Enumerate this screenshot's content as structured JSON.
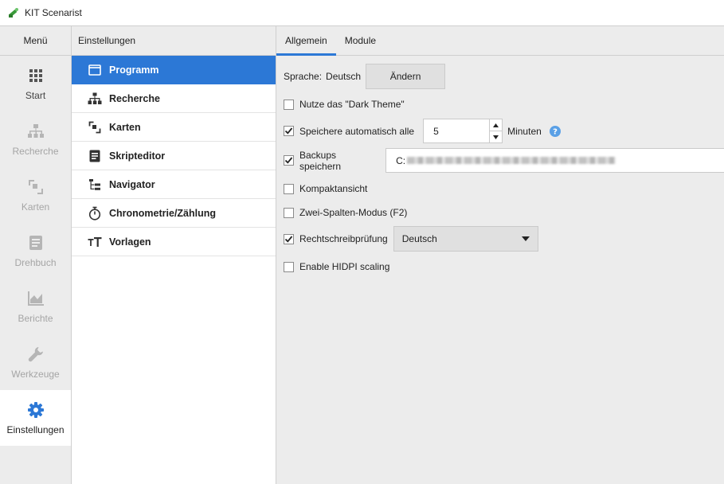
{
  "window": {
    "title": "KIT Scenarist"
  },
  "leftnav": {
    "header": "Menü",
    "items": [
      {
        "label": "Start"
      },
      {
        "label": "Recherche"
      },
      {
        "label": "Karten"
      },
      {
        "label": "Drehbuch"
      },
      {
        "label": "Berichte"
      },
      {
        "label": "Werkzeuge"
      },
      {
        "label": "Einstellungen"
      }
    ]
  },
  "categories": {
    "header": "Einstellungen",
    "items": [
      {
        "label": "Programm",
        "icon": "window-icon",
        "active": true
      },
      {
        "label": "Recherche",
        "icon": "hierarchy-icon"
      },
      {
        "label": "Karten",
        "icon": "cards-icon"
      },
      {
        "label": "Skripteditor",
        "icon": "script-icon"
      },
      {
        "label": "Navigator",
        "icon": "tree-icon"
      },
      {
        "label": "Chronometrie/Zählung",
        "icon": "stopwatch-icon"
      },
      {
        "label": "Vorlagen",
        "icon": "text-size-icon"
      }
    ]
  },
  "tabs": [
    {
      "label": "Allgemein",
      "active": true
    },
    {
      "label": "Module"
    }
  ],
  "settings": {
    "language_label": "Sprache:",
    "language_value": "Deutsch",
    "change_button": "Ändern",
    "dark_theme": {
      "label": "Nutze das \"Dark Theme\"",
      "checked": false
    },
    "autosave": {
      "label": "Speichere automatisch alle",
      "checked": true,
      "value": "5",
      "unit": "Minuten"
    },
    "backups": {
      "label": "Backups speichern",
      "checked": true,
      "path_prefix": "C:"
    },
    "compact": {
      "label": "Kompaktansicht",
      "checked": false
    },
    "two_columns": {
      "label": "Zwei-Spalten-Modus (F2)",
      "checked": false
    },
    "spellcheck": {
      "label": "Rechtschreibprüfung",
      "checked": true,
      "language": "Deutsch"
    },
    "hidpi": {
      "label": "Enable HIDPI scaling",
      "checked": false
    }
  },
  "colors": {
    "accent": "#2c78d6",
    "help": "#5aa0e6"
  }
}
